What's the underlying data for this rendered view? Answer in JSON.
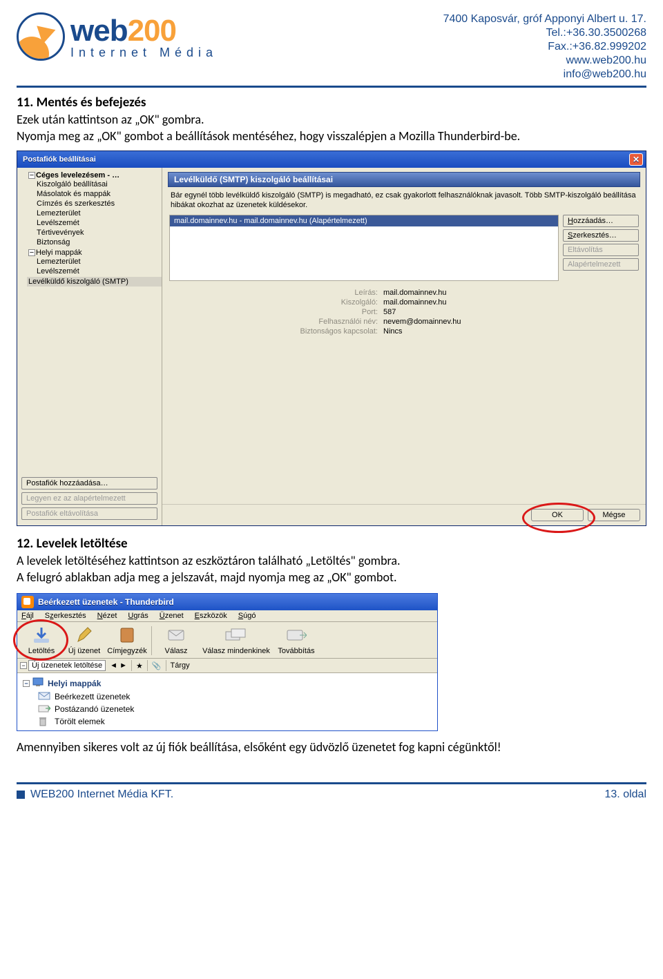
{
  "header": {
    "logo_main1": "web",
    "logo_main2": "200",
    "logo_sub": "Internet Média",
    "contact_lines": {
      "l1": "7400 Kaposvár, gróf Apponyi Albert u. 17.",
      "l2": "Tel.:+36.30.3500268",
      "l3": "Fax.:+36.82.999202",
      "l4": "www.web200.hu",
      "l5": "info@web200.hu"
    }
  },
  "sec11": {
    "title": "11. Mentés és befejezés",
    "p1": "Ezek után kattintson az „OK\" gombra.",
    "p2": "Nyomja meg az „OK\" gombot a beállítások mentéséhez, hogy visszalépjen a Mozilla Thunderbird-be."
  },
  "dialog1": {
    "title": "Postafiók beállításai",
    "tree": {
      "root1": "Céges levelezésem - …",
      "items1": [
        "Kiszolgáló beállításai",
        "Másolatok és mappák",
        "Címzés és szerkesztés",
        "Lemezterület",
        "Levélszemét",
        "Tértivevények",
        "Biztonság"
      ],
      "root2": "Helyi mappák",
      "items2": [
        "Lemezterület",
        "Levélszemét"
      ],
      "smtp": "Levélküldő kiszolgáló (SMTP)"
    },
    "tree_btns": {
      "add": "Postafiók hozzáadása…",
      "def": "Legyen ez az alapértelmezett",
      "del": "Postafiók eltávolítása"
    },
    "panel_head": "Levélküldő (SMTP) kiszolgáló beállításai",
    "help": "Bár egynél több levélküldő kiszolgáló (SMTP) is megadható, ez csak gyakorlott felhasználóknak javasolt. Több SMTP-kiszolgáló beállítása hibákat okozhat az üzenetek küldésekor.",
    "list_item": "mail.domainnev.hu - mail.domainnev.hu (Alapértelmezett)",
    "side_btns": {
      "add": "Hozzáadás…",
      "edit": "Szerkesztés…",
      "del": "Eltávolítás",
      "def": "Alapértelmezett"
    },
    "details": {
      "l1": "Leírás:",
      "v1": "mail.domainnev.hu",
      "l2": "Kiszolgáló:",
      "v2": "mail.domainnev.hu",
      "l3": "Port:",
      "v3": "587",
      "l4": "Felhasználói név:",
      "v4": "nevem@domainnev.hu",
      "l5": "Biztonságos kapcsolat:",
      "v5": "Nincs"
    },
    "ok": "OK",
    "cancel": "Mégse"
  },
  "sec12": {
    "title": "12. Levelek letöltése",
    "p1": "A levelek letöltéséhez kattintson az eszköztáron található „Letöltés\" gombra.",
    "p2": "A felugró ablakban adja meg a jelszavát, majd nyomja meg az „OK\" gombot."
  },
  "tb": {
    "title": "Beérkezett üzenetek - Thunderbird",
    "menu": {
      "m1": "Fájl",
      "m2": "Szerkesztés",
      "m3": "Nézet",
      "m4": "Ugrás",
      "m5": "Üzenet",
      "m6": "Eszközök",
      "m7": "Súgó"
    },
    "toolbar": {
      "b1": "Letöltés",
      "b2": "Új üzenet",
      "b3": "Címjegyzék",
      "b4": "Válasz",
      "b5": "Válasz mindenkinek",
      "b6": "Továbbítás"
    },
    "subtool": {
      "s1": "Új üzenetek letöltése",
      "arrow": "◄  ►",
      "s2": "Tárgy"
    },
    "folders": {
      "root": "Helyi mappák",
      "f1": "Beérkezett üzenetek",
      "f2": "Postázandó üzenetek",
      "f3": "Törölt elemek"
    }
  },
  "closing": "Amennyiben sikeres volt az új fiók beállítása, elsőként egy üdvözlő üzenetet fog kapni cégünktől!",
  "footer": {
    "left": "WEB200 Internet Média KFT.",
    "right": "13. oldal"
  }
}
